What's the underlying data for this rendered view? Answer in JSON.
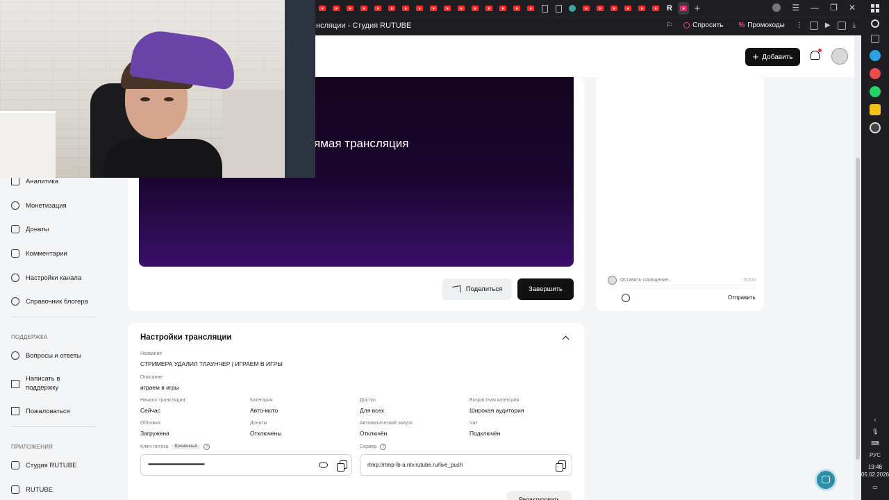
{
  "browser": {
    "page_title": "нсляции - Студия RUTUBE",
    "ask_label": "Спросить",
    "promo_label": "Промокоды",
    "tab_ru_letter": "R",
    "tab_new": "+"
  },
  "system": {
    "lang": "РУС",
    "time": "19:48",
    "date": "05.02.2026"
  },
  "header": {
    "add_button": "Добавить"
  },
  "nav": {
    "items": [
      {
        "label": "Аналитика",
        "icon": "chart-icon"
      },
      {
        "label": "Монетизация",
        "icon": "ruble-icon"
      },
      {
        "label": "Донаты",
        "icon": "donate-icon"
      },
      {
        "label": "Комментарии",
        "icon": "comment-icon"
      },
      {
        "label": "Настройки канала",
        "icon": "gear-icon"
      },
      {
        "label": "Справочник блогера",
        "icon": "book-icon"
      }
    ],
    "support_title": "ПОДДЕРЖКА",
    "support_items": [
      {
        "label": "Вопросы и ответы",
        "icon": "question-icon"
      },
      {
        "label": "Написать в поддержку",
        "icon": "mail-icon"
      },
      {
        "label": "Пожаловаться",
        "icon": "flag-icon"
      }
    ],
    "apps_title": "ПРИЛОЖЕНИЯ",
    "apps_items": [
      {
        "label": "Студия RUTUBE",
        "icon": "studio-icon"
      },
      {
        "label": "RUTUBE",
        "icon": "rutube-icon"
      }
    ]
  },
  "player": {
    "overlay_text": "ямая трансляция",
    "share_button": "Поделиться",
    "end_button": "Завершить"
  },
  "chat": {
    "placeholder": "Оставить сообщение...",
    "counter": "0/200",
    "send_button": "Отправить"
  },
  "settings": {
    "title": "Настройки трансляции",
    "name_label": "Название",
    "name_value": "СТРИМЕРА УДАЛИЛ ТЛАУНЧЕР | ИГРАЕМ В ИГРЫ",
    "desc_label": "Описание",
    "desc_value": "играем в игры",
    "fields": [
      {
        "label": "Начало трансляции",
        "value": "Сейчас"
      },
      {
        "label": "Категория",
        "value": "Авто-мото"
      },
      {
        "label": "Доступ",
        "value": "Для всех"
      },
      {
        "label": "Возрастная категория",
        "value": "Широкая аудитория"
      },
      {
        "label": "Обложка",
        "value": "Загружена"
      },
      {
        "label": "Донаты",
        "value": "Отключены"
      },
      {
        "label": "Автоматический запуск",
        "value": "Отключён"
      },
      {
        "label": "Чат",
        "value": "Подключён"
      }
    ],
    "key_label": "Ключ потока",
    "key_badge": "Временный",
    "key_value": "••••••••••••••••••••••••••••••••••••••••••••••••••••••••••••••••••••••••••••••••",
    "server_label": "Сервер",
    "server_value": "rtmp://rtmp-lb-a.ntv.rutube.ru/live_push",
    "edit_button": "Редактировать",
    "help_glyph": "?"
  },
  "colors": {
    "accent": "#111111",
    "notification": "#ff2b4a",
    "player_gradient_end": "#3b0f6a"
  }
}
